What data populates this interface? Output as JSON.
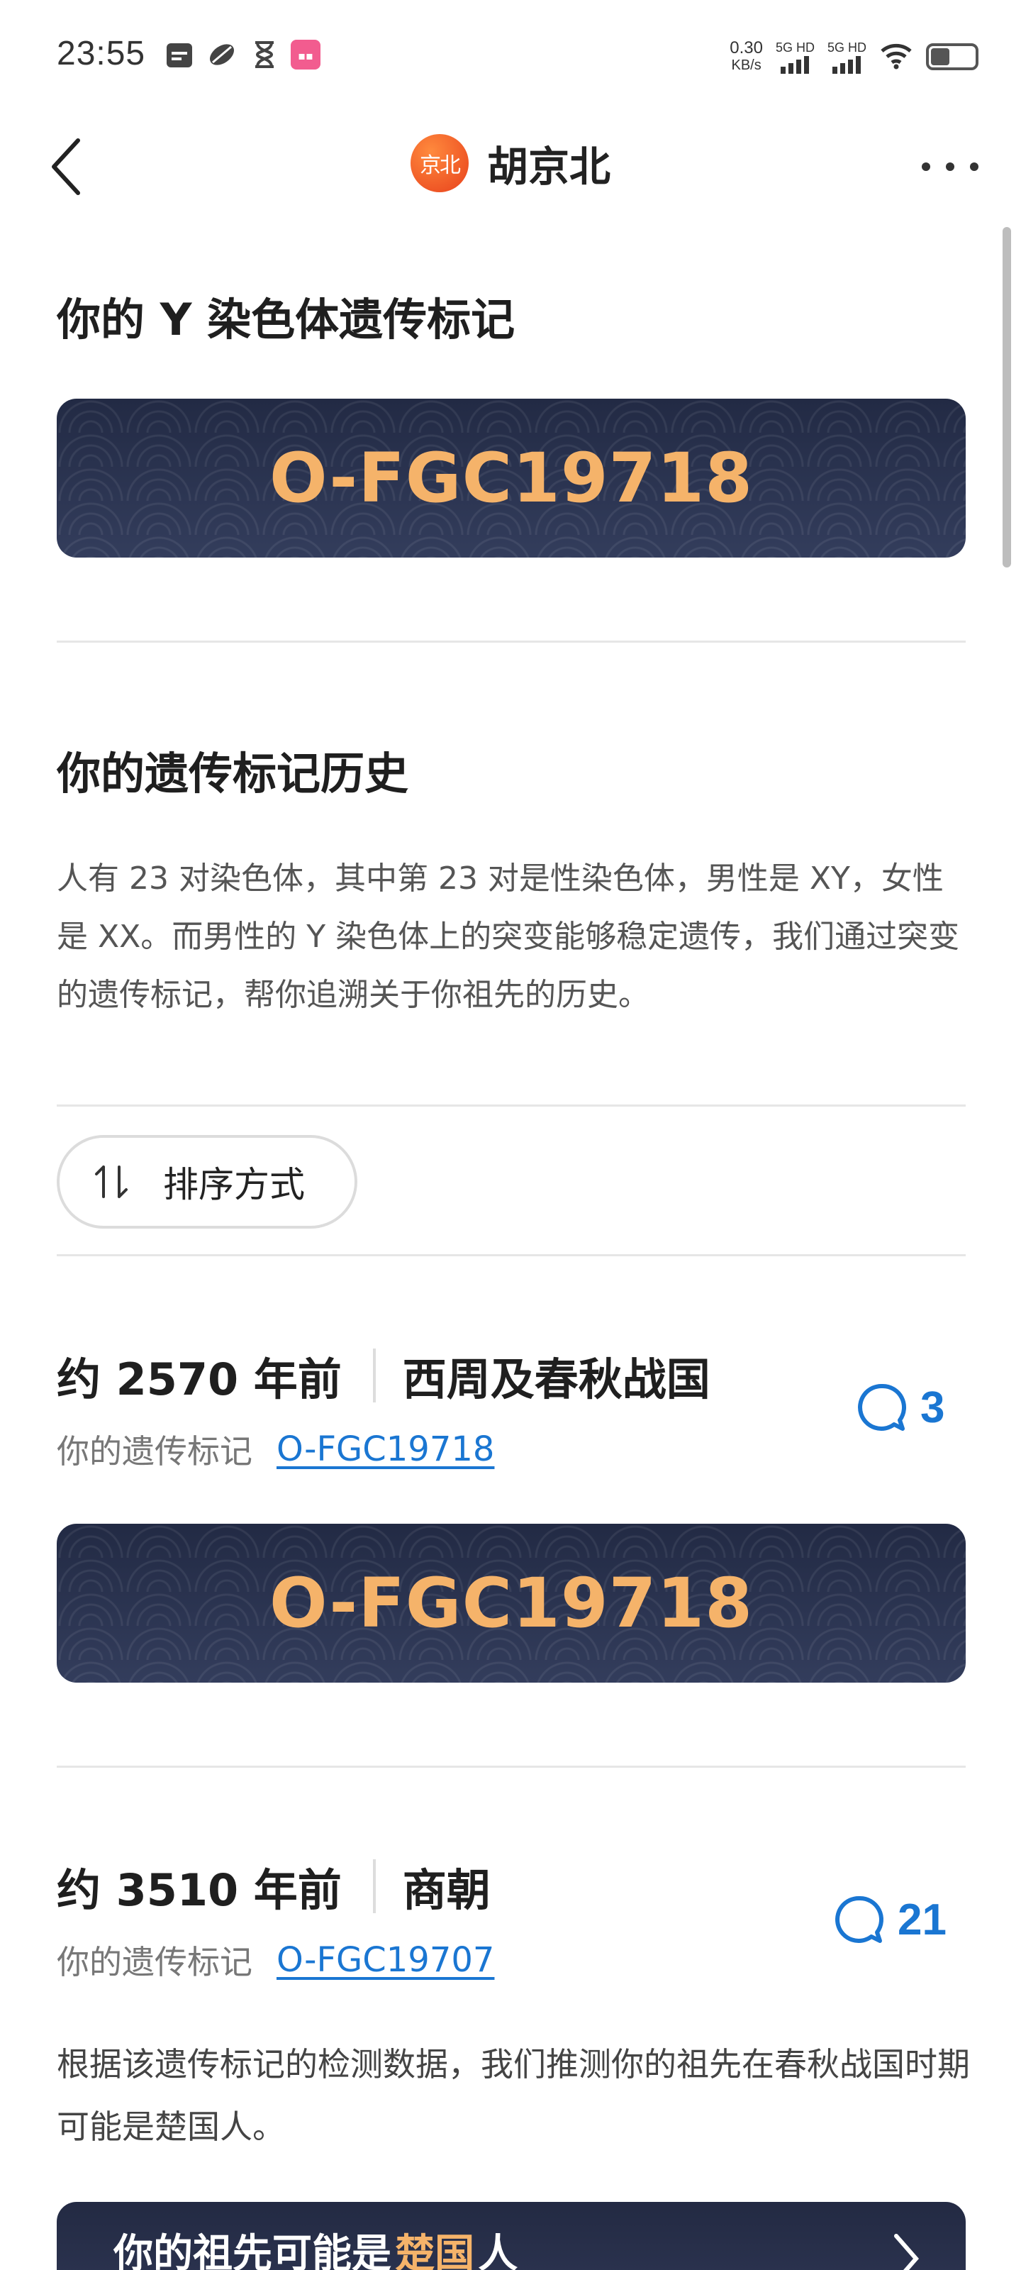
{
  "status_bar": {
    "time": "23:55",
    "net_speed_value": "0.30",
    "net_speed_unit": "KB/s",
    "sim1_label": "5G HD",
    "sim2_label": "5G HD",
    "icons": [
      "calendar-icon",
      "leaf-icon",
      "hourglass-icon",
      "app-badge-icon",
      "wifi-icon",
      "battery-icon"
    ]
  },
  "header": {
    "logo_text": "京北",
    "title": "胡京北"
  },
  "sections": {
    "y_marker_title": "你的 Y 染色体遗传标记",
    "y_marker_value": "O-FGC19718",
    "history_title": "你的遗传标记历史",
    "history_intro": "人有 23 对染色体，其中第 23 对是性染色体，男性是 XY，女性是 XX。而男性的 Y 染色体上的突变能够稳定遗传，我们通过突变的遗传标记，帮你追溯关于你祖先的历史。"
  },
  "sort": {
    "label": "排序方式"
  },
  "timeline": [
    {
      "years": "约 2570 年前",
      "era": "西周及春秋战国",
      "marker_label": "你的遗传标记",
      "marker_link": "O-FGC19718",
      "comments": "3",
      "card_value": "O-FGC19718"
    },
    {
      "years": "约 3510 年前",
      "era": "商朝",
      "marker_label": "你的遗传标记",
      "marker_link": "O-FGC19707",
      "comments": "21",
      "description": "根据该遗传标记的检测数据，我们推测你的祖先在春秋战国时期可能是楚国人。",
      "ancestor_prefix": "你的祖先可能是",
      "ancestor_highlight": "楚国",
      "ancestor_suffix": "人"
    }
  ],
  "colors": {
    "accent_blue": "#1a76d2",
    "gold": "#f5b36a",
    "card_navy": "#2c3552"
  }
}
